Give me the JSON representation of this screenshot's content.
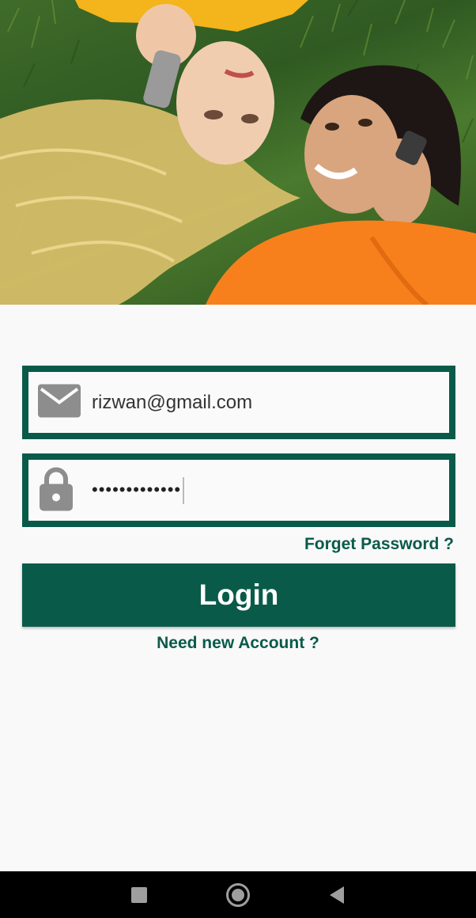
{
  "hero": {
    "icon": "couple-on-grass-photo"
  },
  "login_form": {
    "email": {
      "value": "rizwan@gmail.com",
      "icon": "envelope-icon"
    },
    "password": {
      "value": "•••••••••••••",
      "icon": "lock-icon"
    },
    "forgot_password_label": "Forget Password ?",
    "login_label": "Login",
    "new_account_label": "Need new Account ?"
  },
  "theme": {
    "accent": "#0a5a4a",
    "background": "#f9f9f9"
  },
  "system_nav": {
    "recent_icon": "square-icon",
    "home_icon": "circle-icon",
    "back_icon": "triangle-back-icon"
  }
}
